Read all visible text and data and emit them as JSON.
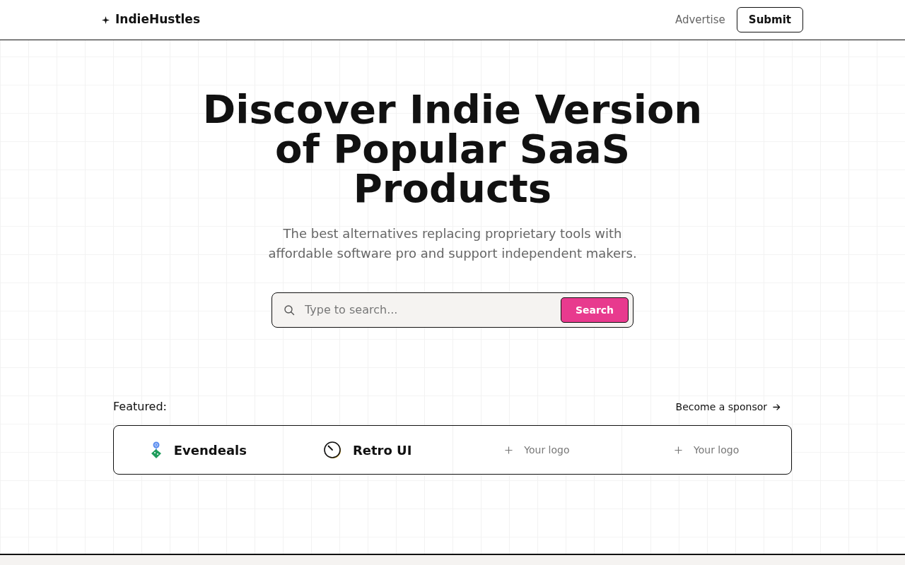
{
  "header": {
    "logo": "IndieHustles",
    "links": [
      {
        "label": "Advertise"
      }
    ],
    "submit": "Submit"
  },
  "hero": {
    "title": "Discover Indie Version of Popular SaaS Products",
    "subtitle": "The best alternatives replacing proprietary tools with affordable software pro and support independent makers."
  },
  "search": {
    "placeholder": "Type to search...",
    "button": "Search"
  },
  "featured": {
    "label": "Featured:",
    "sponsor_link": "Become a sponsor",
    "items": [
      {
        "kind": "evendeals",
        "name": "Evendeals"
      },
      {
        "kind": "retro",
        "name": "Retro UI"
      },
      {
        "kind": "open_slot",
        "name": "Your logo"
      },
      {
        "kind": "open_slot",
        "name": "Your logo"
      }
    ]
  }
}
